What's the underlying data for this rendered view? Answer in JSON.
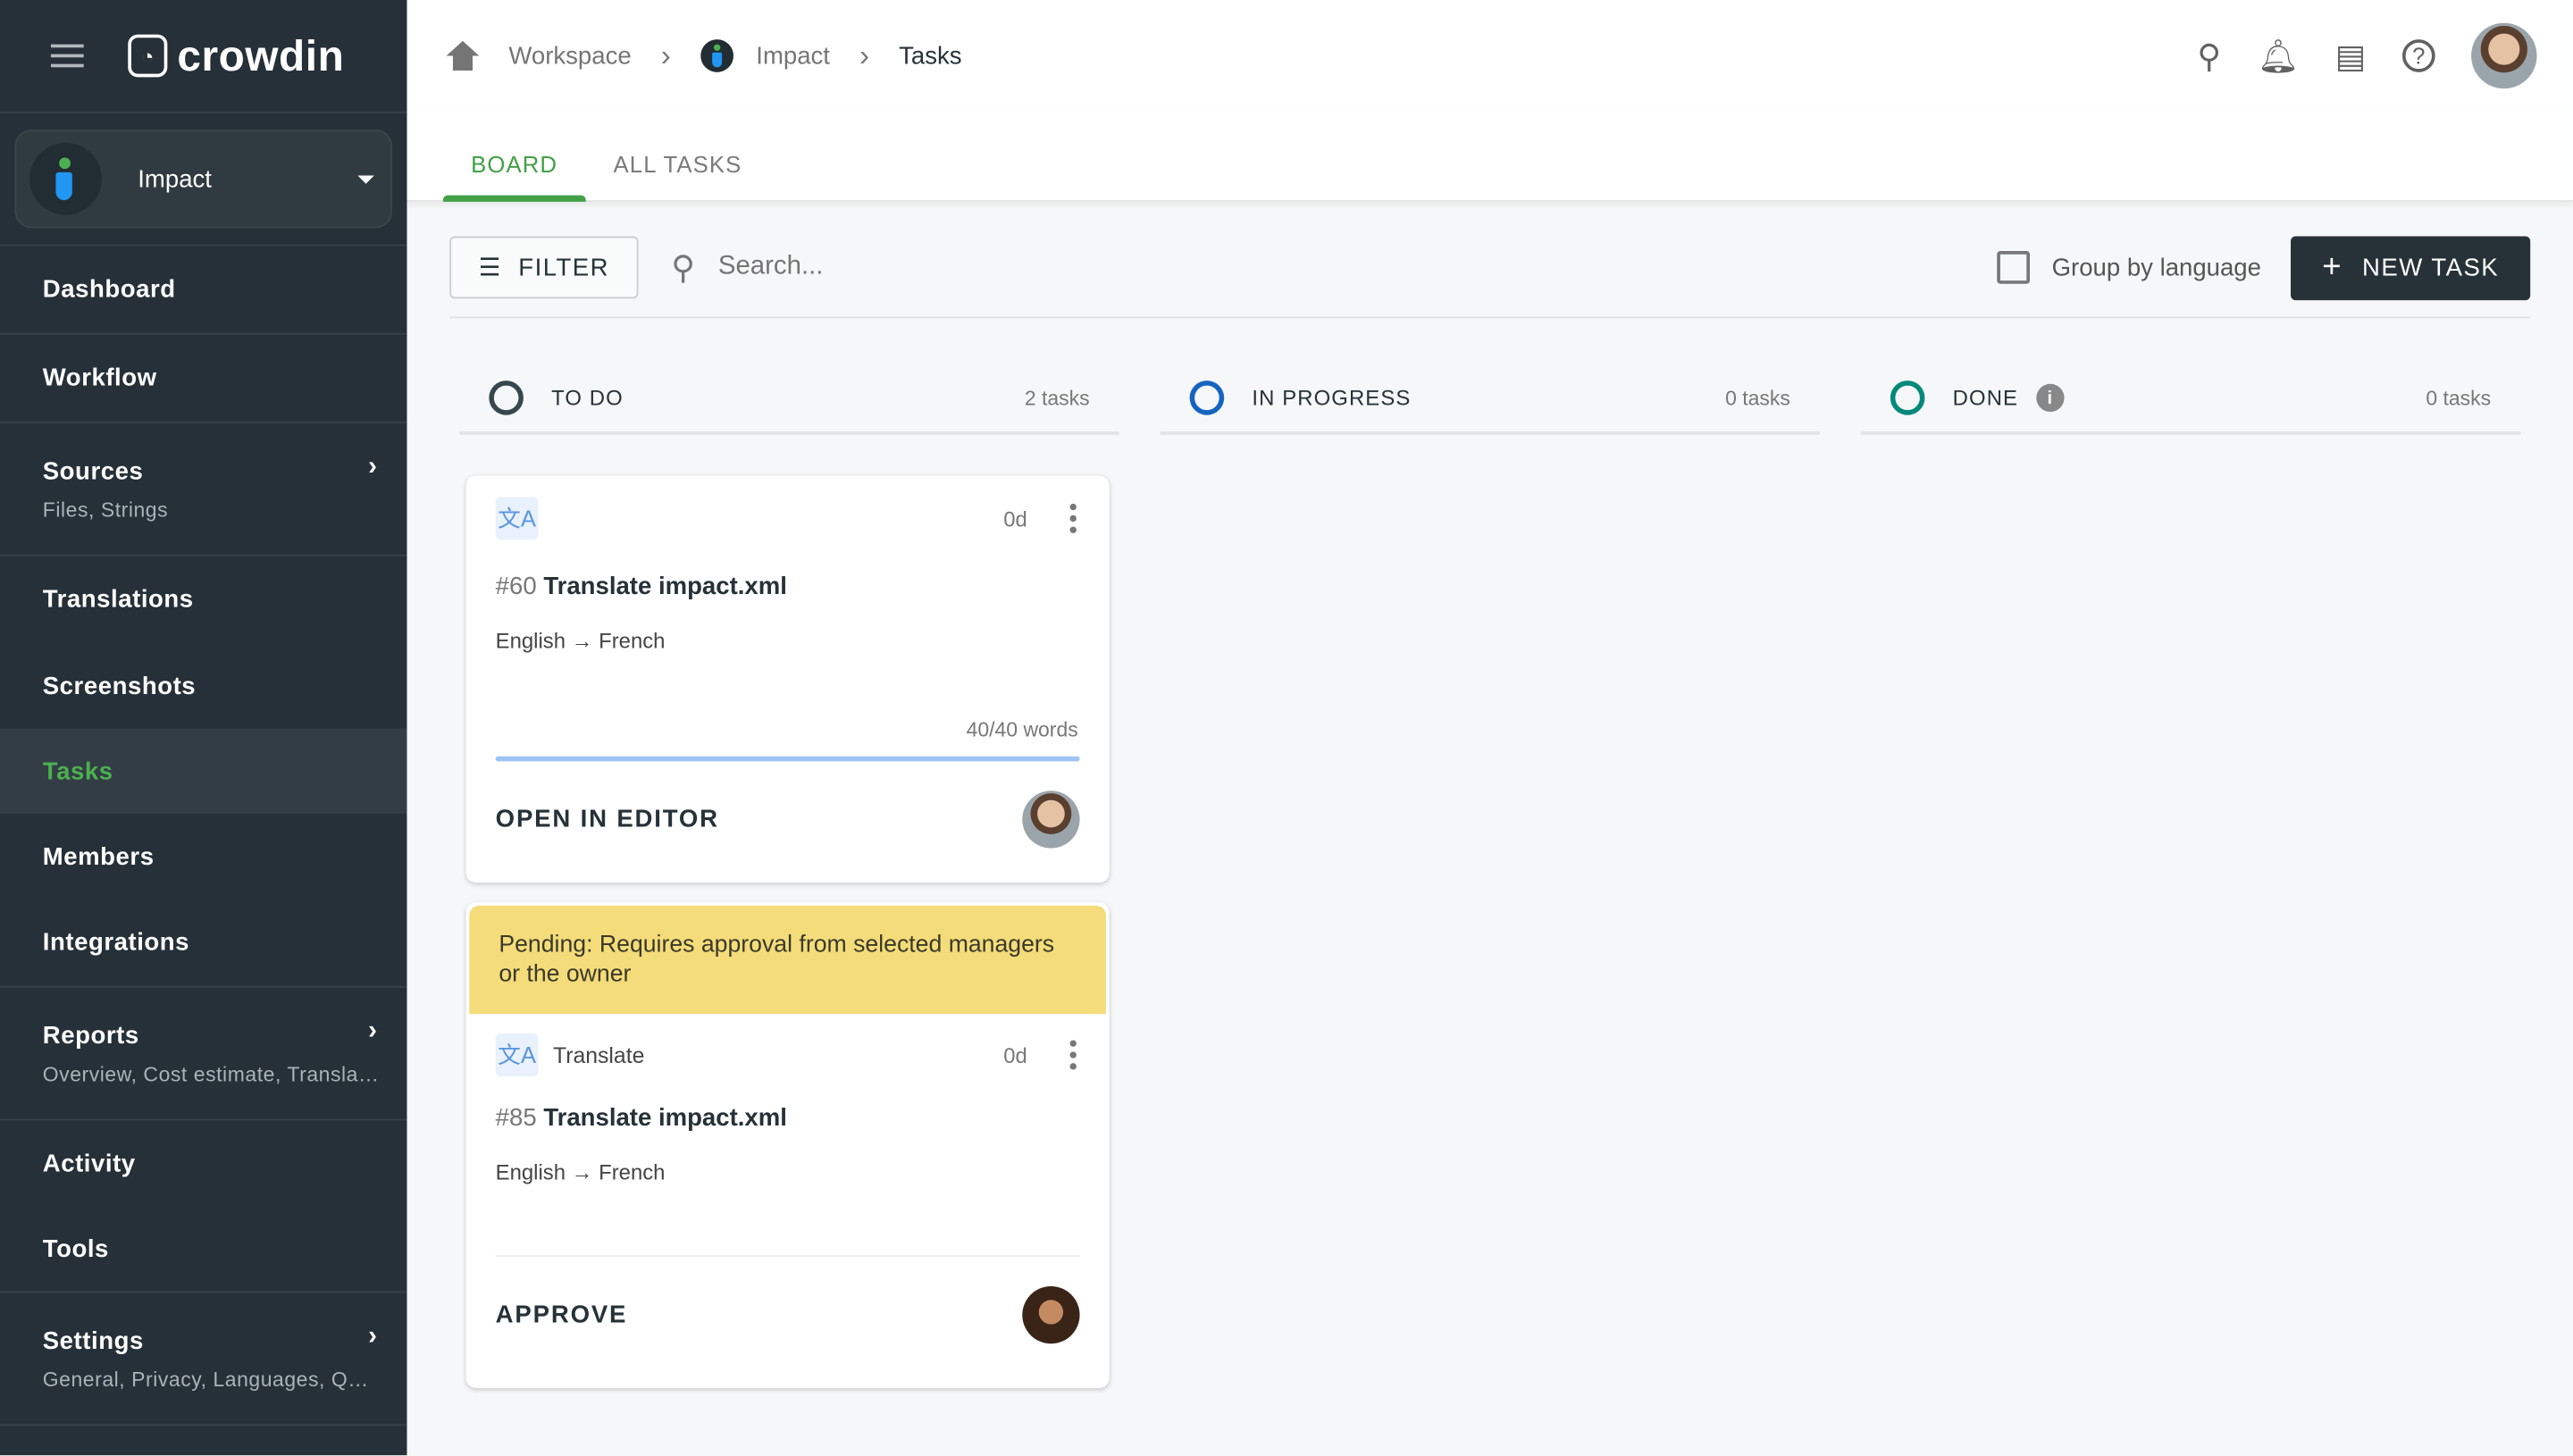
{
  "sidebar": {
    "brand": "crowdin",
    "project": "Impact",
    "items": [
      {
        "label": "Dashboard"
      },
      {
        "label": "Workflow"
      },
      {
        "label": "Sources",
        "sub": "Files, Strings"
      },
      {
        "label": "Translations"
      },
      {
        "label": "Screenshots"
      },
      {
        "label": "Tasks",
        "active": true
      },
      {
        "label": "Members"
      },
      {
        "label": "Integrations"
      },
      {
        "label": "Reports",
        "sub": "Overview, Cost estimate, Translation costs"
      },
      {
        "label": "Activity"
      },
      {
        "label": "Tools"
      },
      {
        "label": "Settings",
        "sub": "General, Privacy, Languages, Quality"
      }
    ]
  },
  "breadcrumb": {
    "workspace": "Workspace",
    "project": "Impact",
    "current": "Tasks"
  },
  "tabs": [
    {
      "label": "BOARD",
      "active": true
    },
    {
      "label": "ALL TASKS"
    }
  ],
  "toolbar": {
    "filter": "FILTER",
    "search_placeholder": "Search...",
    "group_by": "Group by language",
    "group_checked": false,
    "new_task": "NEW TASK"
  },
  "columns": [
    {
      "label": "TO DO",
      "count": "2 tasks",
      "color": "#37474f"
    },
    {
      "label": "IN PROGRESS",
      "count": "0 tasks",
      "color": "#1565c0"
    },
    {
      "label": "DONE",
      "count": "0 tasks",
      "color": "#00897b",
      "info": "i"
    }
  ],
  "cards": [
    {
      "num": "#60",
      "title": "Translate impact.xml",
      "age": "0d",
      "langs": "English → French",
      "words": "40/40 words",
      "progress": 1.0,
      "action": "OPEN IN EDITOR"
    },
    {
      "pending": "Pending: Requires approval from selected managers or the owner",
      "type": "Translate",
      "num": "#85",
      "title": "Translate impact.xml",
      "age": "0d",
      "langs": "English → French",
      "action": "APPROVE"
    }
  ],
  "colors": {
    "sidebar": "#263038",
    "accent": "#43a047",
    "pending": "#f5dc7a"
  }
}
